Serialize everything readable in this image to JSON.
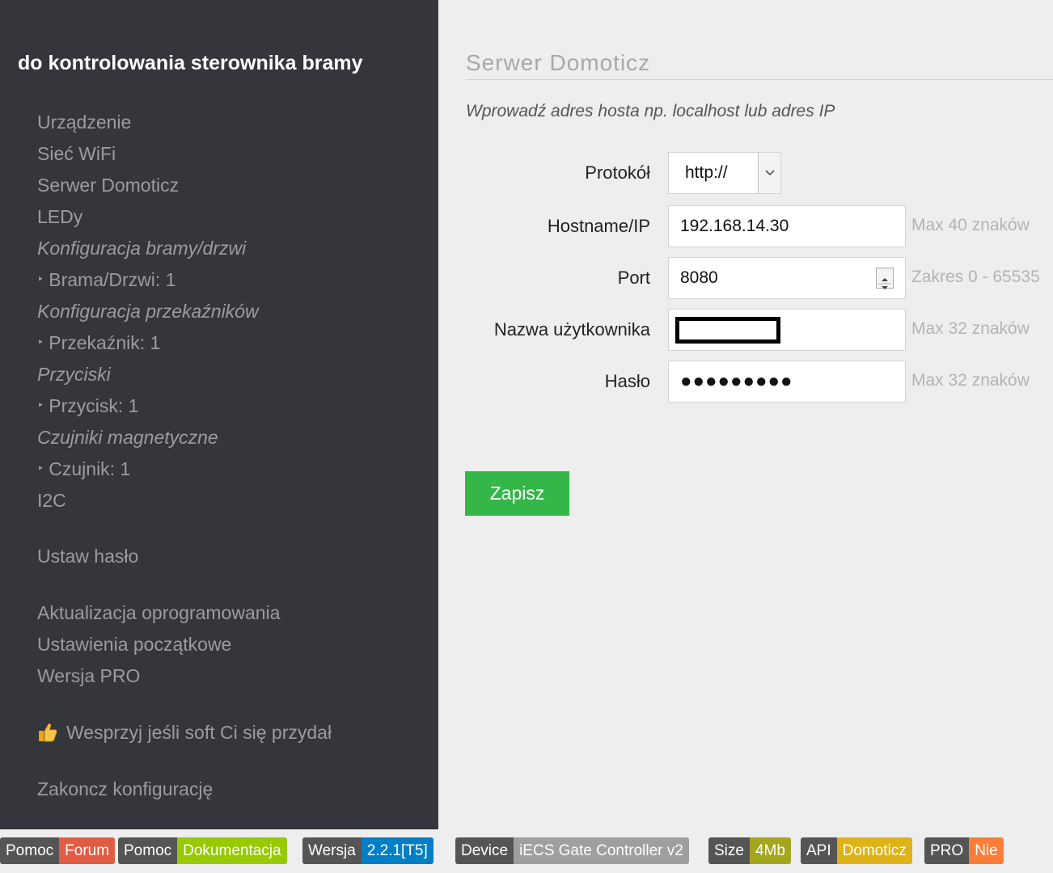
{
  "sidebar": {
    "app_title": "do kontrolowania sterownika bramy",
    "items": [
      {
        "label": "Urządzenie"
      },
      {
        "label": "Sieć WiFi"
      },
      {
        "label": "Serwer Domoticz"
      },
      {
        "label": "LEDy"
      },
      {
        "label": "Konfiguracja bramy/drzwi"
      },
      {
        "label": "Brama/Drzwi: 1"
      },
      {
        "label": "Konfiguracja przekaźników"
      },
      {
        "label": "Przekaźnik: 1"
      },
      {
        "label": "Przyciski"
      },
      {
        "label": "Przycisk: 1"
      },
      {
        "label": "Czujniki magnetyczne"
      },
      {
        "label": "Czujnik: 1"
      },
      {
        "label": "I2C"
      },
      {
        "label": "Ustaw hasło"
      },
      {
        "label": "Aktualizacja oprogramowania"
      },
      {
        "label": "Ustawienia początkowe"
      },
      {
        "label": "Wersja PRO"
      },
      {
        "label": "Wesprzyj jeśli soft Ci się przydał"
      },
      {
        "label": "Zakoncz konfigurację"
      }
    ],
    "sub_bullet": "‣"
  },
  "main": {
    "title": "Serwer Domoticz",
    "hint": "Wprowadź adres hosta np. localhost lub adres IP",
    "form": {
      "protocol": {
        "label": "Protokół",
        "value": "http://"
      },
      "host": {
        "label": "Hostname/IP",
        "value": "192.168.14.30",
        "note": "Max 40 znaków"
      },
      "port": {
        "label": "Port",
        "value": "8080",
        "note": "Zakres 0 - 65535"
      },
      "user": {
        "label": "Nazwa użytkownika",
        "value": "",
        "note": "Max 32 znaków"
      },
      "password": {
        "label": "Hasło",
        "value": "●●●●●●●●●",
        "note": "Max 32 znaków"
      }
    },
    "save_label": "Zapisz"
  },
  "footer": {
    "badges": [
      {
        "key": "Pomoc",
        "value": "Forum",
        "color": "#e05d44"
      },
      {
        "key": "Pomoc",
        "value": "Dokumentacja",
        "color": "#97ca00"
      },
      {
        "key": "Wersja",
        "value": "2.2.1[T5]",
        "color": "#007ec6"
      },
      {
        "key": "Device",
        "value": "iECS Gate Controller v2",
        "color": "#9f9f9f"
      },
      {
        "key": "Size",
        "value": "4Mb",
        "color": "#a4a61d"
      },
      {
        "key": "API",
        "value": "Domoticz",
        "color": "#dfb317"
      },
      {
        "key": "PRO",
        "value": "Nie",
        "color": "#fe7d37"
      }
    ]
  },
  "colors": {
    "sidebar_bg": "#34363b",
    "save_button": "#34b648",
    "menu_text": "#9a9ca1"
  },
  "icons": {
    "support": "thumbs-up-icon",
    "select": "chevron-down-icon",
    "port": "spinner-icon"
  }
}
